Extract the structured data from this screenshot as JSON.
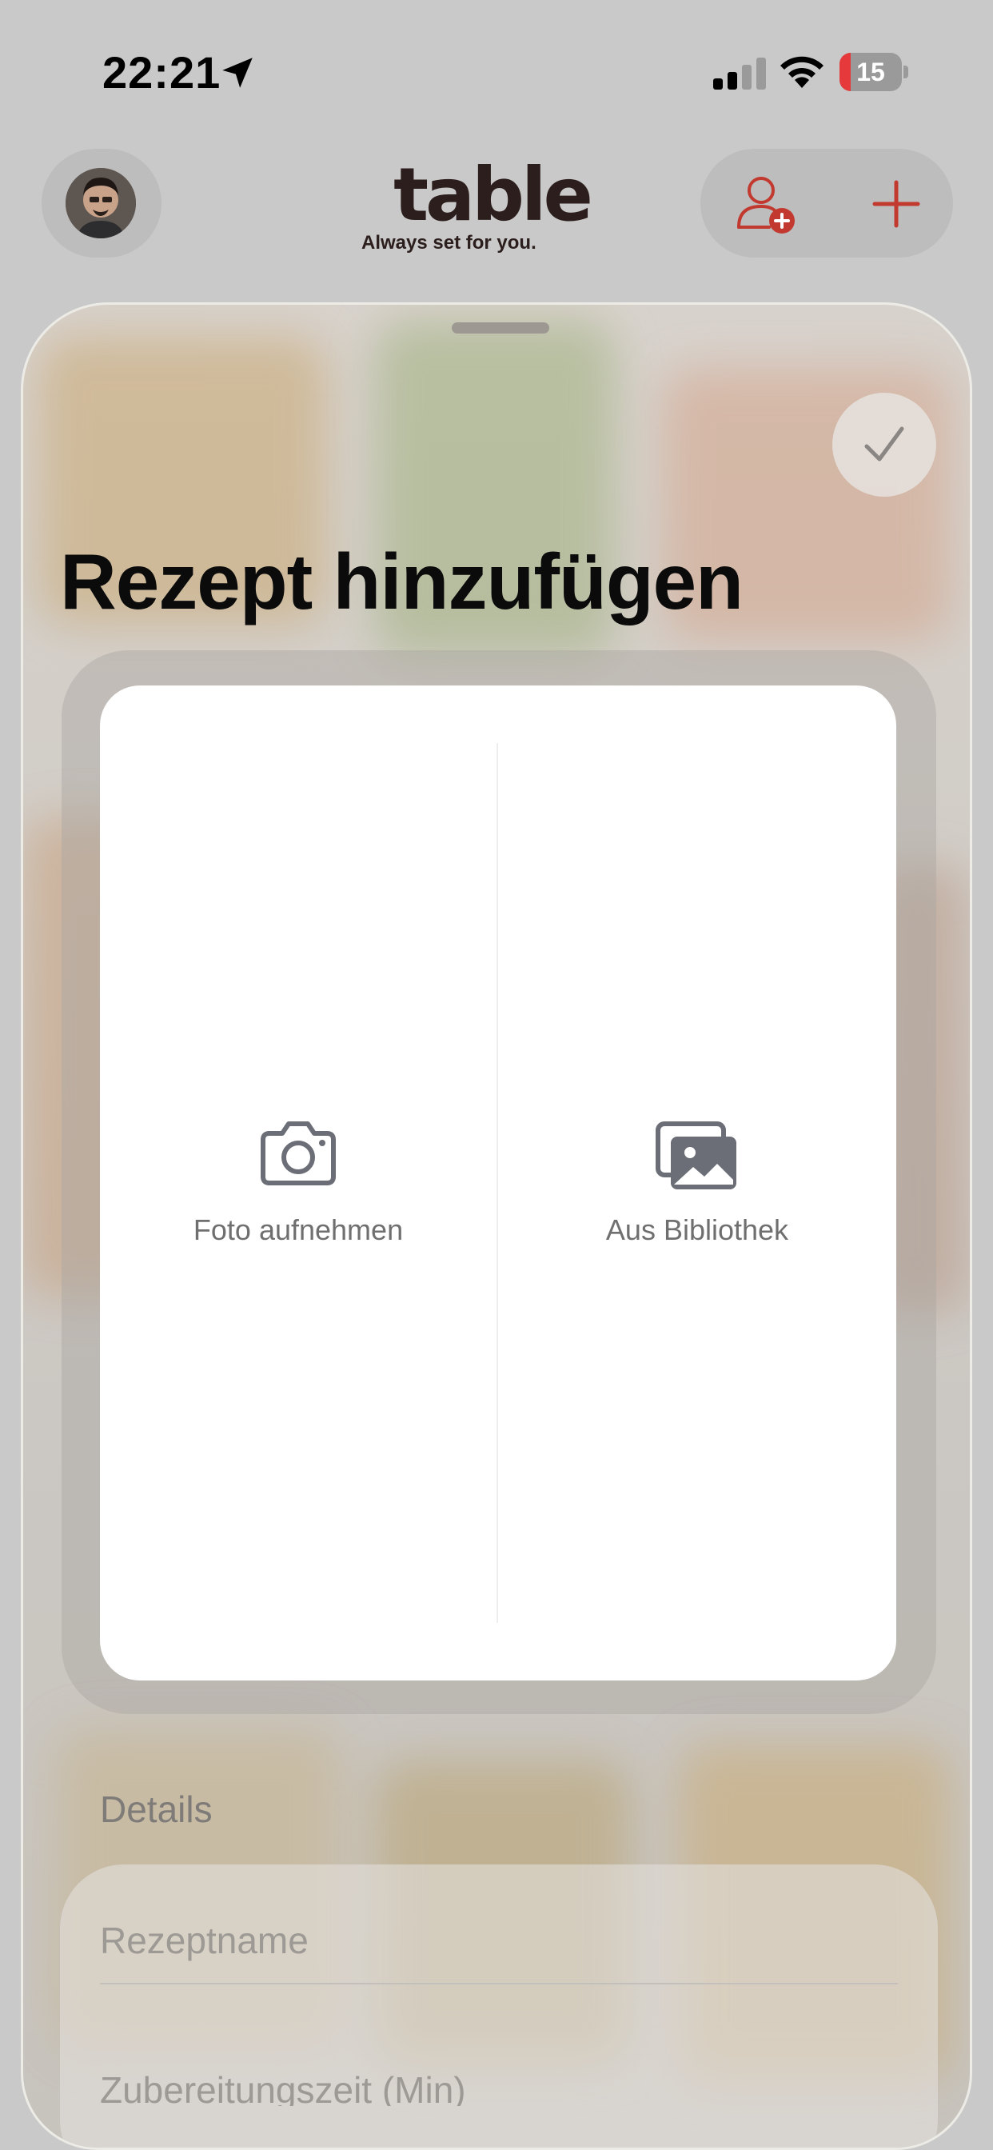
{
  "status_bar": {
    "time": "22:21",
    "battery": "15",
    "battery_color": "#e5393b"
  },
  "header": {
    "logo": "table",
    "tagline": "Always set for you.",
    "accent_color": "#c2392f",
    "icons": [
      "avatar",
      "add-user-icon",
      "plus-icon"
    ]
  },
  "sheet": {
    "title": "Rezept hinzufügen",
    "confirm_icon": "checkmark-icon",
    "photo_options": [
      {
        "label": "Foto aufnehmen",
        "icon": "camera-icon"
      },
      {
        "label": "Aus Bibliothek",
        "icon": "photo-library-icon"
      }
    ],
    "details": {
      "heading": "Details",
      "fields": [
        {
          "placeholder": "Rezeptname",
          "value": ""
        },
        {
          "placeholder": "Zubereitungszeit (Min)",
          "value": ""
        }
      ]
    }
  }
}
